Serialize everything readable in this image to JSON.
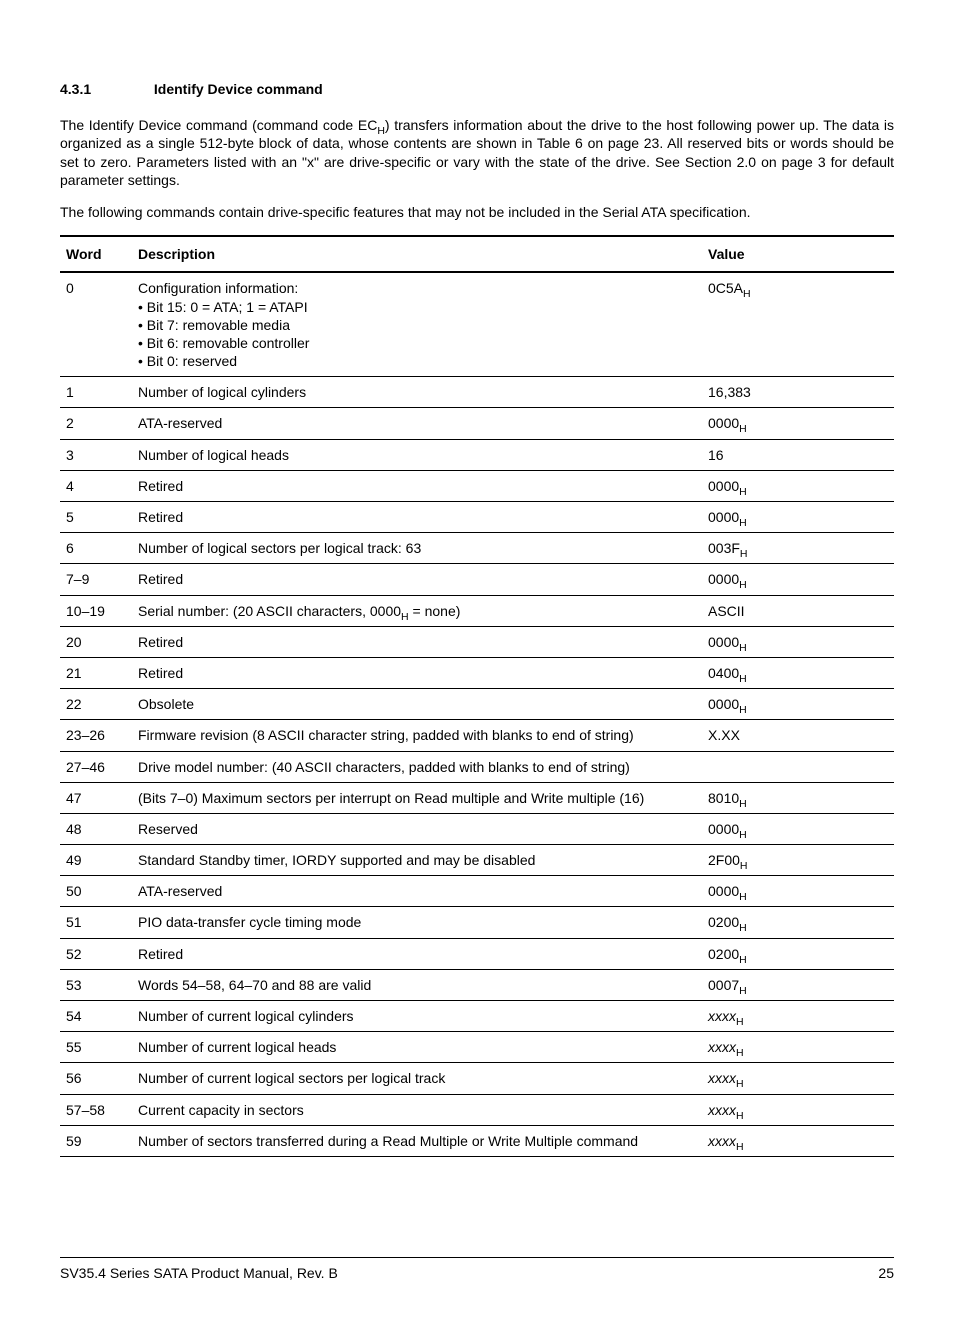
{
  "heading": {
    "number": "4.3.1",
    "title": "Identify Device command"
  },
  "paragraphs": {
    "p1_a": "The Identify Device command (command code EC",
    "p1_b": ") transfers information about the drive to the host following power up. The data is organized as a single 512-byte block of data, whose contents are shown in Table 6 on page 23. All reserved bits or words should be set to zero. Parameters listed with an \"x\" are drive-specific or vary with the state of the drive. See Section 2.0 on page 3 for default parameter settings.",
    "p2": "The following commands contain drive-specific features that may not be included in the Serial ATA specification."
  },
  "table": {
    "headers": {
      "c1": "Word",
      "c2": "Description",
      "c3": "Value"
    },
    "rows": [
      {
        "word": "0",
        "desc_header": "Configuration information:",
        "desc_items": [
          "Bit 15: 0 = ATA; 1 = ATAPI",
          "Bit 7: removable media",
          "Bit 6: removable controller",
          "Bit 0: reserved"
        ],
        "value": "0C5A",
        "value_sub": "H"
      },
      {
        "word": "1",
        "desc": "Number of logical cylinders",
        "value": "16,383"
      },
      {
        "word": "2",
        "desc": "ATA-reserved",
        "value": "0000",
        "value_sub": "H"
      },
      {
        "word": "3",
        "desc": "Number of logical heads",
        "value": "16"
      },
      {
        "word": "4",
        "desc": "Retired",
        "value": "0000",
        "value_sub": "H"
      },
      {
        "word": "5",
        "desc": "Retired",
        "value": "0000",
        "value_sub": "H"
      },
      {
        "word": "6",
        "desc": "Number of logical sectors per logical track: 63",
        "value": "003F",
        "value_sub": "H"
      },
      {
        "word": "7–9",
        "desc": "Retired",
        "value": "0000",
        "value_sub": "H"
      },
      {
        "word": "10–19",
        "desc_a": "Serial number: (20 ASCII characters, 0000",
        "desc_sub": "H",
        "desc_b": " = none)",
        "value": "ASCII"
      },
      {
        "word": "20",
        "desc": "Retired",
        "value": "0000",
        "value_sub": "H"
      },
      {
        "word": "21",
        "desc": "Retired",
        "value": "0400",
        "value_sub": "H"
      },
      {
        "word": "22",
        "desc": "Obsolete",
        "value": "0000",
        "value_sub": "H"
      },
      {
        "word": "23–26",
        "desc": "Firmware revision (8 ASCII character string, padded with blanks to end of string)",
        "value": "X.XX"
      },
      {
        "word": "27–46",
        "desc": "Drive model number: (40 ASCII characters, padded with blanks to end of string)",
        "value": ""
      },
      {
        "word": "47",
        "desc": "(Bits 7–0) Maximum sectors per interrupt on Read multiple and Write multiple (16)",
        "value": "8010",
        "value_sub": "H"
      },
      {
        "word": "48",
        "desc": "Reserved",
        "value": "0000",
        "value_sub": "H"
      },
      {
        "word": "49",
        "desc": "Standard Standby timer, IORDY supported and may be disabled",
        "value": "2F00",
        "value_sub": "H"
      },
      {
        "word": "50",
        "desc": "ATA-reserved",
        "value": "0000",
        "value_sub": "H"
      },
      {
        "word": "51",
        "desc": "PIO data-transfer cycle  timing mode",
        "value": "0200",
        "value_sub": "H"
      },
      {
        "word": "52",
        "desc": "Retired",
        "value": "0200",
        "value_sub": "H"
      },
      {
        "word": "53",
        "desc": "Words 54–58, 64–70 and 88 are valid",
        "value": "0007",
        "value_sub": "H"
      },
      {
        "word": "54",
        "desc": "Number of current logical  cylinders",
        "value_italic": "xxxx",
        "value_sub": "H"
      },
      {
        "word": "55",
        "desc": "Number of current logical heads",
        "value_italic": "xxxx",
        "value_sub": "H"
      },
      {
        "word": "56",
        "desc": "Number of current logical sectors per logical track",
        "value_italic": "xxxx",
        "value_sub": "H"
      },
      {
        "word": "57–58",
        "desc": "Current capacity in sectors",
        "value_italic": "xxxx",
        "value_sub": "H"
      },
      {
        "word": "59",
        "desc": "Number of sectors transferred during a Read Multiple or Write Multiple command",
        "value_italic": "xxxx",
        "value_sub": "H"
      }
    ]
  },
  "footer": {
    "left": "SV35.4 Series SATA Product Manual, Rev. B",
    "right": "25"
  }
}
